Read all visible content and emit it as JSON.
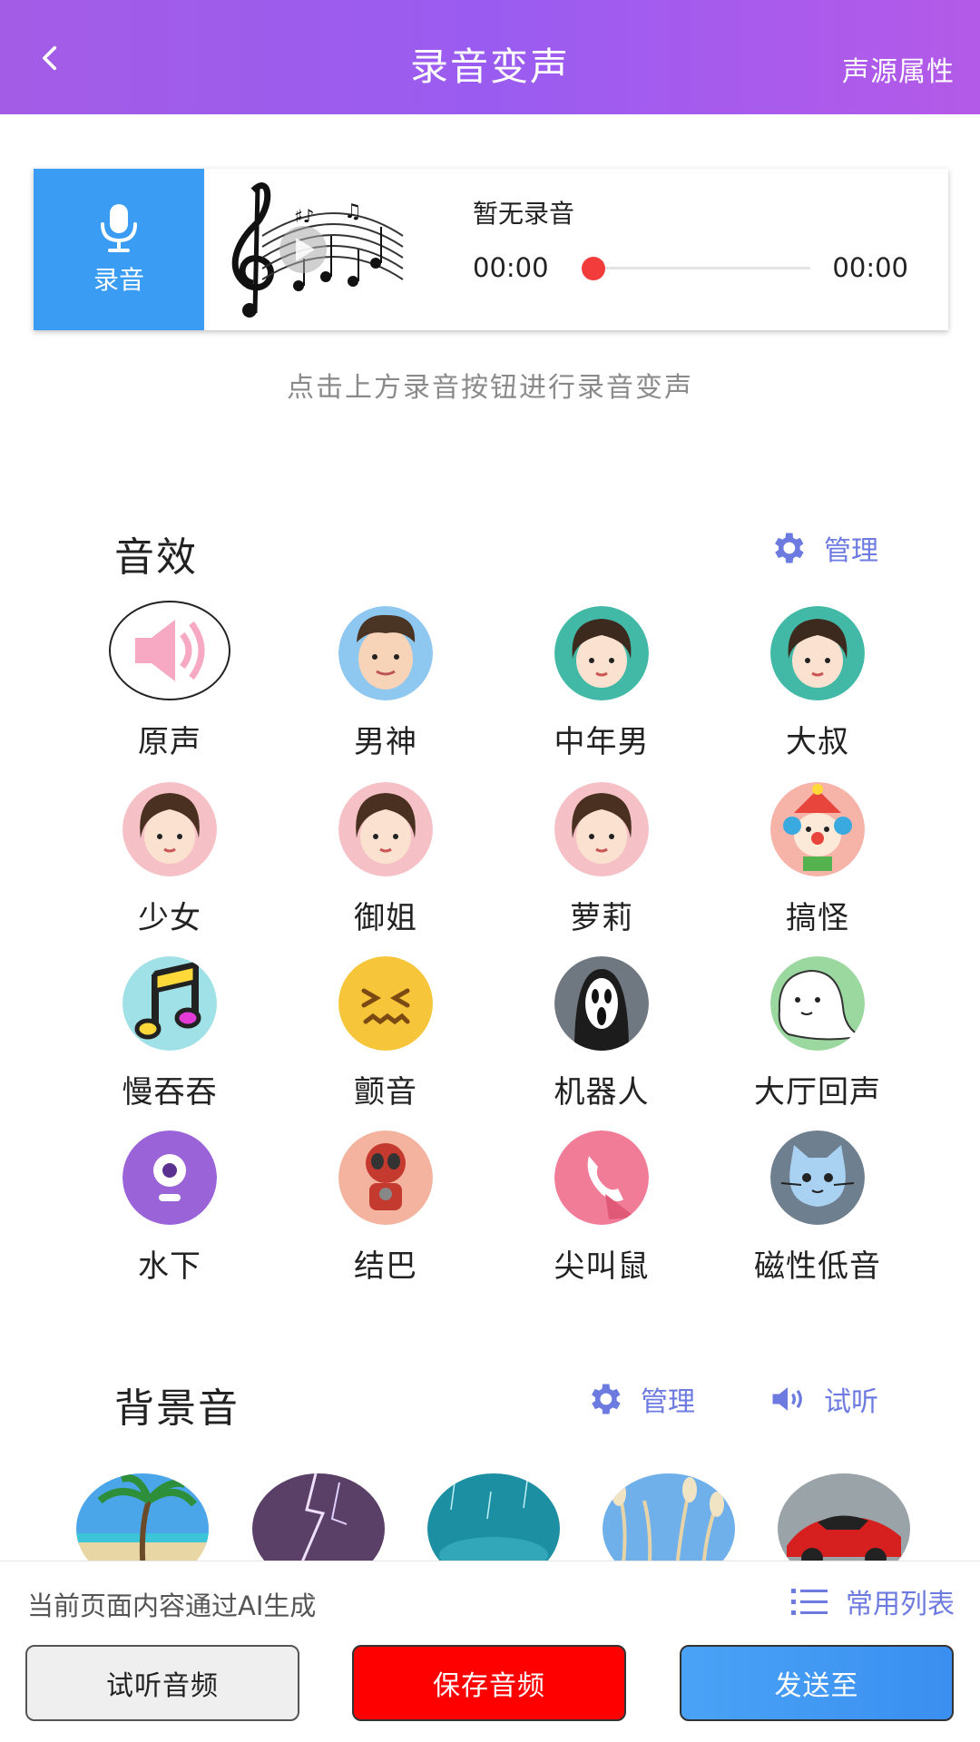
{
  "header": {
    "title": "录音变声",
    "right_action": "声源属性"
  },
  "player": {
    "record_label": "录音",
    "status": "暂无录音",
    "time_current": "00:00",
    "time_total": "00:00",
    "progress": 0,
    "accent_color": "#f23b3b"
  },
  "hint": "点击上方录音按钮进行录音变声",
  "effects_section": {
    "title": "音效",
    "manage_label": "管理",
    "items": [
      {
        "label": "原声",
        "icon": "speaker-icon",
        "selected": true
      },
      {
        "label": "男神",
        "icon": "boy-avatar-icon"
      },
      {
        "label": "中年男",
        "icon": "girl-avatar-icon"
      },
      {
        "label": "大叔",
        "icon": "girl-avatar-icon"
      },
      {
        "label": "少女",
        "icon": "girl-avatar-icon"
      },
      {
        "label": "御姐",
        "icon": "girl-avatar-icon"
      },
      {
        "label": "萝莉",
        "icon": "girl-avatar-icon"
      },
      {
        "label": "搞怪",
        "icon": "clown-icon"
      },
      {
        "label": "慢吞吞",
        "icon": "music-note-icon"
      },
      {
        "label": "颤音",
        "icon": "dizzy-face-icon"
      },
      {
        "label": "机器人",
        "icon": "ghost-mask-icon"
      },
      {
        "label": "大厅回声",
        "icon": "ghost-icon"
      },
      {
        "label": "水下",
        "icon": "eye-icon"
      },
      {
        "label": "结巴",
        "icon": "robot-hero-icon"
      },
      {
        "label": "尖叫鼠",
        "icon": "phone-icon"
      },
      {
        "label": "磁性低音",
        "icon": "cat-icon"
      }
    ]
  },
  "bg_section": {
    "title": "背景音",
    "manage_label": "管理",
    "listen_label": "试听",
    "thumbs": [
      "beach-palm-thumb",
      "lightning-thumb",
      "rain-thumb",
      "reeds-thumb",
      "sports-car-thumb"
    ]
  },
  "bottom": {
    "ai_note": "当前页面内容通过AI生成",
    "common_list": "常用列表",
    "btn_listen": "试听音频",
    "btn_save": "保存音频",
    "btn_send": "发送至"
  },
  "colors": {
    "header_gradient": "#a35ce6",
    "link": "#6d7be0",
    "record_blue": "#3a9cf3",
    "save_red": "#ff0000"
  }
}
